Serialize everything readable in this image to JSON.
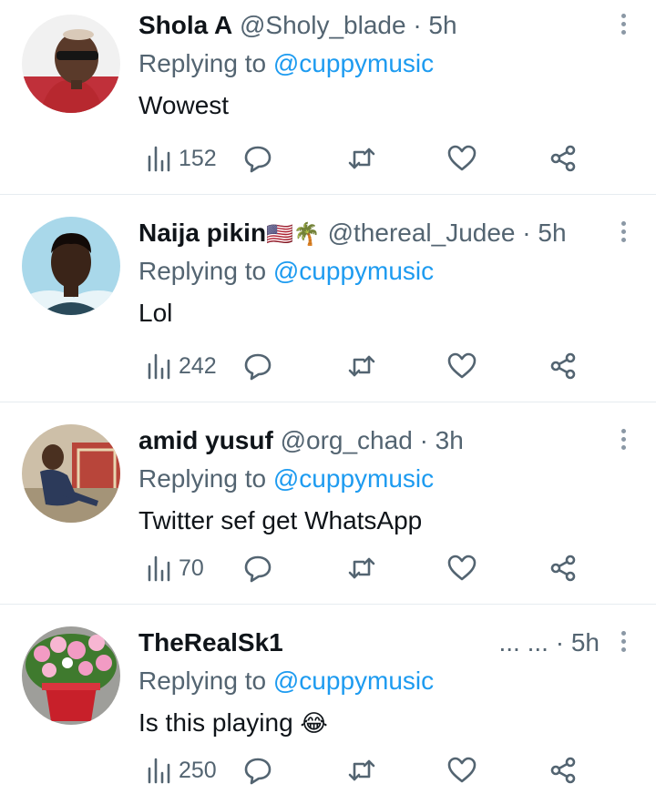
{
  "tweets": [
    {
      "name": "Shola A",
      "handle": "@Sholy_blade",
      "sep": "·",
      "time": "5h",
      "replying_prefix": "Replying to ",
      "mention": "@cuppymusic",
      "text": "Wowest",
      "views": "152"
    },
    {
      "name": "Naija pikin",
      "flags": "🇺🇸🌴",
      "handle": "@thereal_Judee",
      "sep": "·",
      "time": "5h",
      "replying_prefix": "Replying to ",
      "mention": "@cuppymusic",
      "text": "Lol",
      "views": "242"
    },
    {
      "name": "amid yusuf",
      "handle": "@org_chad",
      "sep": "·",
      "time": "3h",
      "replying_prefix": "Replying to ",
      "mention": "@cuppymusic",
      "text": "Twitter sef get WhatsApp",
      "views": "70"
    },
    {
      "name": "TheRealSk1",
      "handle_dots": "... ...",
      "sep": "·",
      "time": "5h",
      "replying_prefix": "Replying to ",
      "mention": "@cuppymusic",
      "text": "Is this playing",
      "emoji": "😂",
      "views": "250"
    }
  ],
  "icons": {
    "views": "bar-chart-icon",
    "reply": "speech-bubble-icon",
    "retweet": "retweet-icon",
    "like": "heart-icon",
    "share": "share-icon",
    "more": "vertical-ellipsis-icon"
  },
  "colors": {
    "link": "#1d9bf0",
    "muted": "#536471",
    "text": "#0f1419",
    "divider": "#e6ecf0"
  }
}
